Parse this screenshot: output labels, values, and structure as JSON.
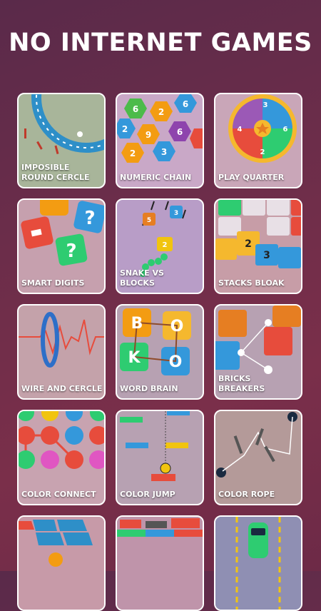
{
  "header": {
    "title": "NO INTERNET GAMES"
  },
  "games": [
    {
      "label": "IMPOSIBLE ROUND CERCLE"
    },
    {
      "label": "NUMERIC CHAIN"
    },
    {
      "label": "PLAY QUARTER"
    },
    {
      "label": "SMART DIGITS"
    },
    {
      "label": "SNAKE VS BLOCKS"
    },
    {
      "label": "STACKS BLOAK"
    },
    {
      "label": "WIRE AND CERCLE"
    },
    {
      "label": "WORD BRAIN"
    },
    {
      "label": "BRICKS BREAKERS"
    },
    {
      "label": "COLOR CONNECT"
    },
    {
      "label": "COLOR JUMP"
    },
    {
      "label": "COLOR ROPE"
    },
    {
      "label": ""
    },
    {
      "label": ""
    },
    {
      "label": ""
    }
  ],
  "art_text": {
    "chain_numbers": [
      "6",
      "2",
      "6",
      "2",
      "9",
      "6",
      "2",
      "3"
    ],
    "wheel_numbers": [
      "3",
      "6",
      "2",
      "4"
    ],
    "stack_numbers": [
      "2",
      "3"
    ],
    "snake_numbers": [
      "5",
      "3",
      "2"
    ],
    "word_letters": [
      "B",
      "O",
      "K",
      "O"
    ]
  },
  "colors": {
    "background": "#6b2d4a",
    "tile_border": "#ffffff",
    "label_text": "#ffffff"
  }
}
